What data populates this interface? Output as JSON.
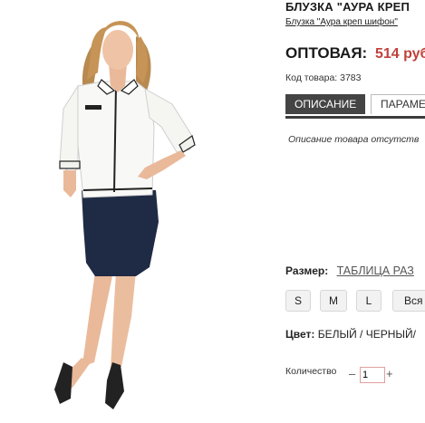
{
  "product": {
    "title": "БЛУЗКА \"АУРА КРЕП",
    "subtitle": "Блузка \"Аура креп шифон\"",
    "image_alt": "model-wearing-white-blouse-navy-skirt"
  },
  "price": {
    "label": "ОПТОВАЯ:",
    "value": "514 руб"
  },
  "sku": "Код товара: 3783",
  "tabs": [
    {
      "label": "ОПИСАНИЕ"
    },
    {
      "label": "ПАРАМЕ"
    }
  ],
  "description": "Описание товара отсутств",
  "size": {
    "label": "Размер:",
    "table_link": "ТАБЛИЦА РАЗ",
    "options": [
      "S",
      "M",
      "L",
      "Вся р"
    ]
  },
  "color": {
    "label": "Цвет:",
    "value": "БЕЛЫЙ / ЧЕРНЫЙ/"
  },
  "quantity": {
    "label": "Количество",
    "minus": "–",
    "value": "1",
    "plus": "+"
  },
  "colors": {
    "accent_price": "#c0413b",
    "tab_active_bg": "#444444",
    "skirt": "#1f2a44"
  }
}
